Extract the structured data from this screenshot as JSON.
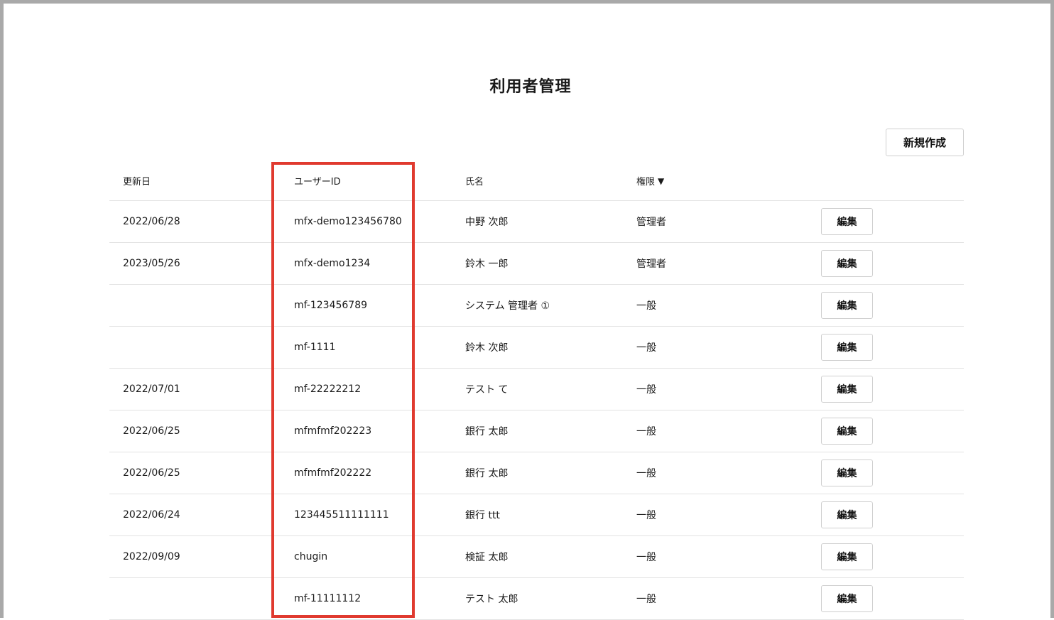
{
  "page": {
    "title": "利用者管理",
    "new_button_label": "新規作成"
  },
  "table": {
    "headers": {
      "updated": "更新日",
      "user_id": "ユーザーID",
      "name": "氏名",
      "role": "権限",
      "role_sort_icon": "▼"
    },
    "edit_label": "編集",
    "rows": [
      {
        "updated": "2022/06/28",
        "user_id": "mfx-demo123456780",
        "name": "中野 次郎",
        "role": "管理者"
      },
      {
        "updated": "2023/05/26",
        "user_id": "mfx-demo1234",
        "name": "鈴木 一郎",
        "role": "管理者"
      },
      {
        "updated": "",
        "user_id": "mf-123456789",
        "name": "システム 管理者 ①",
        "role": "一般"
      },
      {
        "updated": "",
        "user_id": "mf-1111",
        "name": "鈴木 次郎",
        "role": "一般"
      },
      {
        "updated": "2022/07/01",
        "user_id": "mf-22222212",
        "name": "テスト て",
        "role": "一般"
      },
      {
        "updated": "2022/06/25",
        "user_id": "mfmfmf202223",
        "name": "銀行 太郎",
        "role": "一般"
      },
      {
        "updated": "2022/06/25",
        "user_id": "mfmfmf202222",
        "name": "銀行 太郎",
        "role": "一般"
      },
      {
        "updated": "2022/06/24",
        "user_id": "123445511111111",
        "name": "銀行 ttt",
        "role": "一般"
      },
      {
        "updated": "2022/09/09",
        "user_id": "chugin",
        "name": "検証 太郎",
        "role": "一般"
      },
      {
        "updated": "",
        "user_id": "mf-11111112",
        "name": "テスト 太郎",
        "role": "一般"
      }
    ]
  },
  "annotation": {
    "highlight_color": "#e03a2f"
  }
}
